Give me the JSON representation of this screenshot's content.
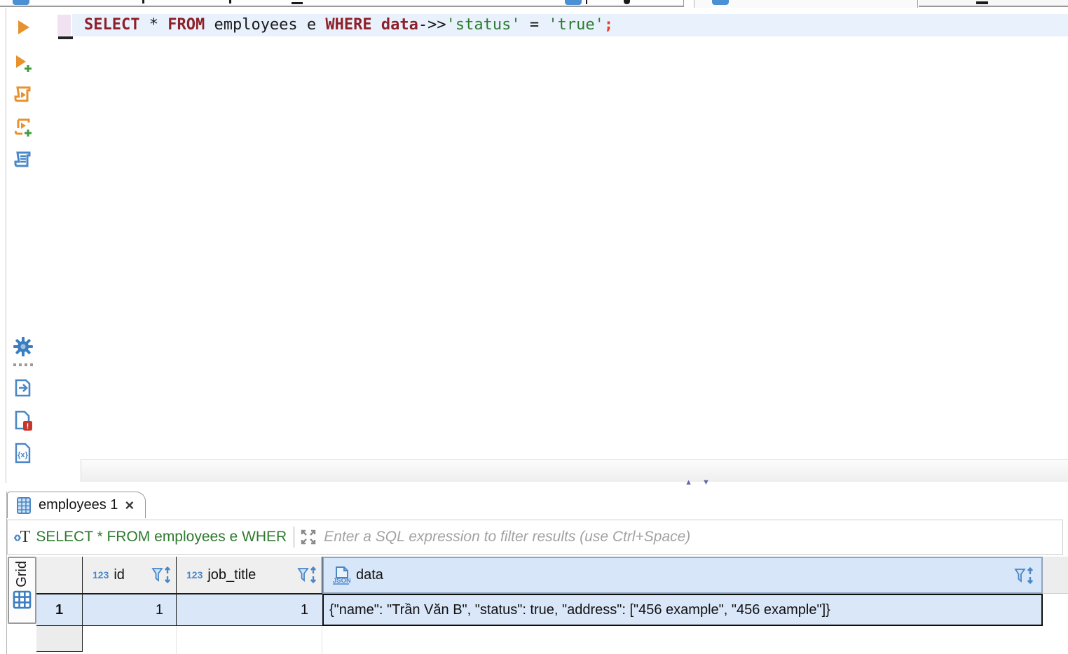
{
  "colors": {
    "accent_blue": "#4a87c7",
    "keyword_red": "#8e2029",
    "string_green": "#2c7d2f",
    "semicolon_red": "#e8402a",
    "filter_green": "#2e7a2e",
    "selection_blue": "#d9e7f9",
    "header_selected_blue": "#d7e6f8",
    "toolbar_orange": "#e8922e"
  },
  "editor": {
    "sql_tokens": {
      "t0": "SELECT",
      "t1": " ",
      "t2": "*",
      "t3": " ",
      "t4": "FROM",
      "t5": " employees e ",
      "t6": "WHERE",
      "t7": " ",
      "t8": "data",
      "t9": "->>",
      "t10": "'status'",
      "t11": " = ",
      "t12": "'true'",
      "t13": ";"
    }
  },
  "toolbar": {
    "items": [
      {
        "icon": "execute-statement-icon"
      },
      {
        "icon": "execute-in-new-tab-icon"
      },
      {
        "icon": "execute-script-icon"
      },
      {
        "icon": "execute-script-new-tab-icon"
      },
      {
        "icon": "explain-plan-icon"
      },
      {
        "icon": "settings-gear-icon"
      },
      {
        "icon": "drag-dots-icon"
      },
      {
        "icon": "output-icon"
      },
      {
        "icon": "problems-icon"
      },
      {
        "icon": "variables-icon"
      }
    ]
  },
  "splitter": {
    "up_arrow": "▲",
    "down_arrow": "▼"
  },
  "results": {
    "tab": {
      "label": "employees 1",
      "close_glyph": "×"
    },
    "filter": {
      "applied_text": "SELECT * FROM employees e WHER",
      "placeholder": "Enter a SQL expression to filter results (use Ctrl+Space)"
    },
    "presentation": {
      "label": "Grid"
    },
    "grid": {
      "columns": [
        {
          "type_badge": "123",
          "label": "id"
        },
        {
          "type_badge": "123",
          "label": "job_title"
        },
        {
          "type_badge": "JSON",
          "label": "data"
        }
      ],
      "rows": [
        {
          "num": "1",
          "id": "1",
          "job_title": "1",
          "data": "{\"name\": \"Trần Văn B\", \"status\": true, \"address\": [\"456 example\", \"456 example\"]}"
        }
      ]
    }
  }
}
